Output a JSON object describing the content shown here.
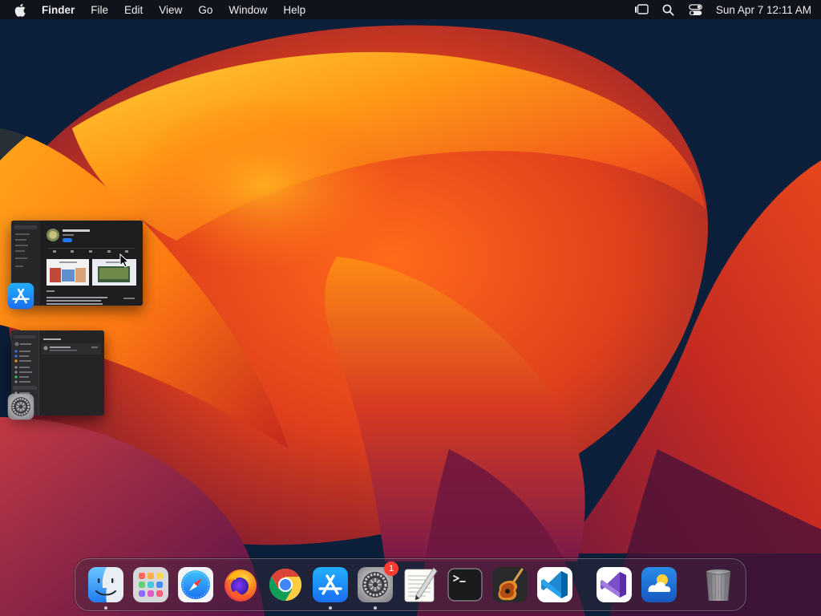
{
  "menubar": {
    "app_name": "Finder",
    "items": [
      "File",
      "Edit",
      "View",
      "Go",
      "Window",
      "Help"
    ],
    "status_icons": [
      "stage-manager-icon",
      "spotlight-search-icon",
      "control-center-icon"
    ],
    "clock": "Sun Apr 7  12:11 AM"
  },
  "stage_manager": {
    "groups": [
      {
        "app": "App Store",
        "icon": "app-store-icon"
      },
      {
        "app": "System Settings",
        "icon": "system-settings-icon"
      }
    ]
  },
  "dock": {
    "apps": [
      {
        "name": "Finder",
        "icon": "finder-icon",
        "running": true
      },
      {
        "name": "Launchpad",
        "icon": "launchpad-icon",
        "running": false
      },
      {
        "name": "Safari",
        "icon": "safari-icon",
        "running": false
      },
      {
        "name": "Firefox",
        "icon": "firefox-icon",
        "running": false
      },
      {
        "name": "Google Chrome",
        "icon": "chrome-icon",
        "running": false
      },
      {
        "name": "App Store",
        "icon": "app-store-icon",
        "running": true
      },
      {
        "name": "System Settings",
        "icon": "system-settings-icon",
        "running": true,
        "badge": "1"
      },
      {
        "name": "TextEdit",
        "icon": "textedit-icon",
        "running": false
      },
      {
        "name": "Terminal",
        "icon": "terminal-icon",
        "running": false
      },
      {
        "name": "GarageBand",
        "icon": "garageband-icon",
        "running": false
      },
      {
        "name": "Visual Studio Code",
        "icon": "vscode-icon",
        "running": false
      }
    ],
    "recent": [
      {
        "name": "Visual Studio",
        "icon": "visual-studio-icon"
      },
      {
        "name": "Weather",
        "icon": "weather-icon"
      }
    ],
    "trash": {
      "name": "Trash",
      "icon": "trash-icon"
    }
  },
  "colors": {
    "menubar_bg": "#121216",
    "badge": "#ff3b30",
    "wallpaper_orange": "#ff7a12",
    "wallpaper_red": "#d9381e",
    "wallpaper_navy": "#0b1f3a"
  }
}
